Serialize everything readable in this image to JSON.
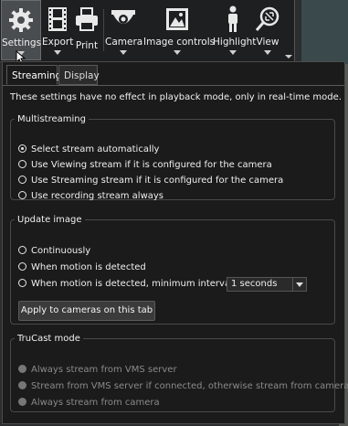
{
  "toolbar": {
    "buttons": [
      {
        "label": "Settings",
        "icon": "gear-icon",
        "has_dropdown": true,
        "active": true
      },
      {
        "label": "Export",
        "icon": "film-icon",
        "has_dropdown": true
      },
      {
        "label": "Print",
        "icon": "printer-icon",
        "has_dropdown": false
      },
      {
        "label": "Camera",
        "icon": "dome-camera-icon",
        "has_dropdown": true
      },
      {
        "label": "Image controls",
        "icon": "image-icon",
        "has_dropdown": true
      },
      {
        "label": "Highlight",
        "icon": "person-icon",
        "has_dropdown": true
      },
      {
        "label": "View",
        "icon": "zoom-icon",
        "has_dropdown": true
      }
    ]
  },
  "panel": {
    "tabs": [
      {
        "label": "Streaming",
        "selected": true
      },
      {
        "label": "Display",
        "selected": false
      }
    ],
    "note": "These settings have no effect in playback mode, only in real-time mode.",
    "multistreaming": {
      "legend": "Multistreaming",
      "options": [
        {
          "label": "Select stream automatically",
          "checked": true
        },
        {
          "label": "Use Viewing stream if it is configured for the camera",
          "checked": false
        },
        {
          "label": "Use Streaming stream if it is configured for the camera",
          "checked": false
        },
        {
          "label": "Use recording stream always",
          "checked": false
        }
      ]
    },
    "update_image": {
      "legend": "Update image",
      "options": [
        {
          "label": "Continuously",
          "checked": false
        },
        {
          "label": "When motion is detected",
          "checked": false
        },
        {
          "label": "When motion is detected, minimum interval",
          "checked": false
        }
      ],
      "interval_select": "1 seconds",
      "apply_button": "Apply to cameras on this tab"
    },
    "trucast": {
      "legend": "TruCast mode",
      "options": [
        {
          "label": "Always stream from VMS server",
          "disabled": true
        },
        {
          "label": "Stream from VMS server if connected, otherwise stream from camera",
          "disabled": true
        },
        {
          "label": "Always stream from camera",
          "disabled": true
        }
      ]
    }
  },
  "colors": {
    "panel_bg": "#1b1b1b",
    "toolbar_bg": "#1e1f20",
    "text": "#f0f0f0",
    "disabled_text": "#8a8a8a"
  }
}
